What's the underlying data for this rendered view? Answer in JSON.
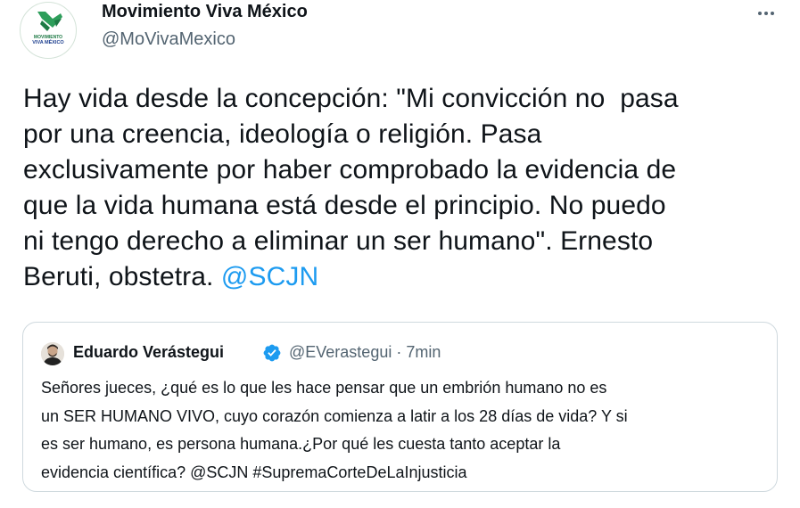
{
  "tweet": {
    "author": {
      "name": "Movimiento Viva México",
      "handle": "@MoVivaMexico",
      "avatar_icon": "movimiento-viva-mexico-logo",
      "avatar_text_line1": "MOVIMIENTO",
      "avatar_text_line2": "VIVA MÉXICO"
    },
    "more_icon": "more-options-icon",
    "text_lines": [
      "Hay vida desde la concepción: \"Mi convicción no  pasa",
      "por una creencia, ideología o religión. Pasa",
      "exclusivamente por haber comprobado la evidencia de",
      "que la vida humana está desde el principio. No puedo",
      "ni tengo derecho a eliminar un ser humano\". Ernesto"
    ],
    "text_last_line": "Beruti, obstetra. ",
    "mention": "@SCJN"
  },
  "quote": {
    "author_name": "Eduardo Verástegui",
    "handle": "@EVerastegui",
    "separator": "·",
    "time": "7min",
    "verified_icon": "verified-badge-icon",
    "text_lines": [
      "Señores jueces, ¿qué es lo que les hace pensar que un embrión humano no es",
      "un SER HUMANO VIVO, cuyo corazón comienza a latir a los 28 días de vida? Y si",
      "es ser humano, es persona humana.¿Por qué les cuesta tanto aceptar la",
      "evidencia científica? @SCJN #SupremaCorteDeLaInjusticia"
    ]
  },
  "colors": {
    "text": "#0f1419",
    "secondary": "#536471",
    "link": "#1d9bf0",
    "border": "#cfd9de",
    "brand_green": "#2e9e5b"
  }
}
